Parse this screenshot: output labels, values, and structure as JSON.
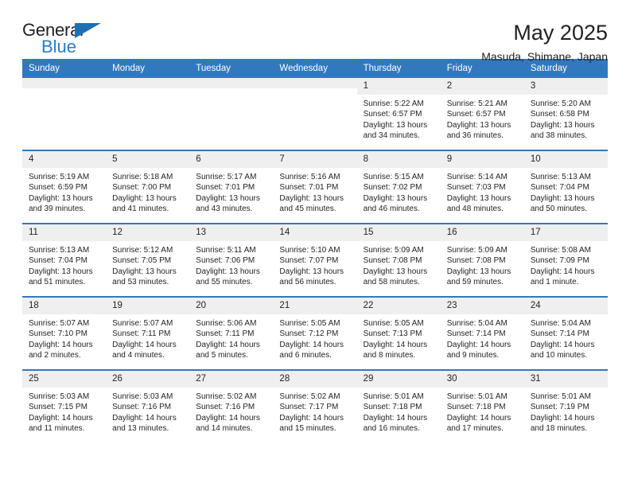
{
  "brand": {
    "name_top": "General",
    "name_bottom": "Blue",
    "triangle_color": "#1f6fb5",
    "text_color": "#2a7cc7"
  },
  "header": {
    "title": "May 2025",
    "subtitle": "Masuda, Shimane, Japan"
  },
  "theme": {
    "header_blue": "#3278be",
    "daynum_gray": "#efefef",
    "text": "#231f20"
  },
  "weekday_headers": [
    "Sunday",
    "Monday",
    "Tuesday",
    "Wednesday",
    "Thursday",
    "Friday",
    "Saturday"
  ],
  "labels": {
    "sunrise_prefix": "Sunrise:",
    "sunset_prefix": "Sunset:",
    "daylight_prefix": "Daylight:"
  },
  "weeks": [
    [
      {
        "day": "",
        "blank": true
      },
      {
        "day": "",
        "blank": true
      },
      {
        "day": "",
        "blank": true
      },
      {
        "day": "",
        "blank": true
      },
      {
        "day": "1",
        "sunrise": "Sunrise: 5:22 AM",
        "sunset": "Sunset: 6:57 PM",
        "daylight": "Daylight: 13 hours and 34 minutes."
      },
      {
        "day": "2",
        "sunrise": "Sunrise: 5:21 AM",
        "sunset": "Sunset: 6:57 PM",
        "daylight": "Daylight: 13 hours and 36 minutes."
      },
      {
        "day": "3",
        "sunrise": "Sunrise: 5:20 AM",
        "sunset": "Sunset: 6:58 PM",
        "daylight": "Daylight: 13 hours and 38 minutes."
      }
    ],
    [
      {
        "day": "4",
        "sunrise": "Sunrise: 5:19 AM",
        "sunset": "Sunset: 6:59 PM",
        "daylight": "Daylight: 13 hours and 39 minutes."
      },
      {
        "day": "5",
        "sunrise": "Sunrise: 5:18 AM",
        "sunset": "Sunset: 7:00 PM",
        "daylight": "Daylight: 13 hours and 41 minutes."
      },
      {
        "day": "6",
        "sunrise": "Sunrise: 5:17 AM",
        "sunset": "Sunset: 7:01 PM",
        "daylight": "Daylight: 13 hours and 43 minutes."
      },
      {
        "day": "7",
        "sunrise": "Sunrise: 5:16 AM",
        "sunset": "Sunset: 7:01 PM",
        "daylight": "Daylight: 13 hours and 45 minutes."
      },
      {
        "day": "8",
        "sunrise": "Sunrise: 5:15 AM",
        "sunset": "Sunset: 7:02 PM",
        "daylight": "Daylight: 13 hours and 46 minutes."
      },
      {
        "day": "9",
        "sunrise": "Sunrise: 5:14 AM",
        "sunset": "Sunset: 7:03 PM",
        "daylight": "Daylight: 13 hours and 48 minutes."
      },
      {
        "day": "10",
        "sunrise": "Sunrise: 5:13 AM",
        "sunset": "Sunset: 7:04 PM",
        "daylight": "Daylight: 13 hours and 50 minutes."
      }
    ],
    [
      {
        "day": "11",
        "sunrise": "Sunrise: 5:13 AM",
        "sunset": "Sunset: 7:04 PM",
        "daylight": "Daylight: 13 hours and 51 minutes."
      },
      {
        "day": "12",
        "sunrise": "Sunrise: 5:12 AM",
        "sunset": "Sunset: 7:05 PM",
        "daylight": "Daylight: 13 hours and 53 minutes."
      },
      {
        "day": "13",
        "sunrise": "Sunrise: 5:11 AM",
        "sunset": "Sunset: 7:06 PM",
        "daylight": "Daylight: 13 hours and 55 minutes."
      },
      {
        "day": "14",
        "sunrise": "Sunrise: 5:10 AM",
        "sunset": "Sunset: 7:07 PM",
        "daylight": "Daylight: 13 hours and 56 minutes."
      },
      {
        "day": "15",
        "sunrise": "Sunrise: 5:09 AM",
        "sunset": "Sunset: 7:08 PM",
        "daylight": "Daylight: 13 hours and 58 minutes."
      },
      {
        "day": "16",
        "sunrise": "Sunrise: 5:09 AM",
        "sunset": "Sunset: 7:08 PM",
        "daylight": "Daylight: 13 hours and 59 minutes."
      },
      {
        "day": "17",
        "sunrise": "Sunrise: 5:08 AM",
        "sunset": "Sunset: 7:09 PM",
        "daylight": "Daylight: 14 hours and 1 minute."
      }
    ],
    [
      {
        "day": "18",
        "sunrise": "Sunrise: 5:07 AM",
        "sunset": "Sunset: 7:10 PM",
        "daylight": "Daylight: 14 hours and 2 minutes."
      },
      {
        "day": "19",
        "sunrise": "Sunrise: 5:07 AM",
        "sunset": "Sunset: 7:11 PM",
        "daylight": "Daylight: 14 hours and 4 minutes."
      },
      {
        "day": "20",
        "sunrise": "Sunrise: 5:06 AM",
        "sunset": "Sunset: 7:11 PM",
        "daylight": "Daylight: 14 hours and 5 minutes."
      },
      {
        "day": "21",
        "sunrise": "Sunrise: 5:05 AM",
        "sunset": "Sunset: 7:12 PM",
        "daylight": "Daylight: 14 hours and 6 minutes."
      },
      {
        "day": "22",
        "sunrise": "Sunrise: 5:05 AM",
        "sunset": "Sunset: 7:13 PM",
        "daylight": "Daylight: 14 hours and 8 minutes."
      },
      {
        "day": "23",
        "sunrise": "Sunrise: 5:04 AM",
        "sunset": "Sunset: 7:14 PM",
        "daylight": "Daylight: 14 hours and 9 minutes."
      },
      {
        "day": "24",
        "sunrise": "Sunrise: 5:04 AM",
        "sunset": "Sunset: 7:14 PM",
        "daylight": "Daylight: 14 hours and 10 minutes."
      }
    ],
    [
      {
        "day": "25",
        "sunrise": "Sunrise: 5:03 AM",
        "sunset": "Sunset: 7:15 PM",
        "daylight": "Daylight: 14 hours and 11 minutes."
      },
      {
        "day": "26",
        "sunrise": "Sunrise: 5:03 AM",
        "sunset": "Sunset: 7:16 PM",
        "daylight": "Daylight: 14 hours and 13 minutes."
      },
      {
        "day": "27",
        "sunrise": "Sunrise: 5:02 AM",
        "sunset": "Sunset: 7:16 PM",
        "daylight": "Daylight: 14 hours and 14 minutes."
      },
      {
        "day": "28",
        "sunrise": "Sunrise: 5:02 AM",
        "sunset": "Sunset: 7:17 PM",
        "daylight": "Daylight: 14 hours and 15 minutes."
      },
      {
        "day": "29",
        "sunrise": "Sunrise: 5:01 AM",
        "sunset": "Sunset: 7:18 PM",
        "daylight": "Daylight: 14 hours and 16 minutes."
      },
      {
        "day": "30",
        "sunrise": "Sunrise: 5:01 AM",
        "sunset": "Sunset: 7:18 PM",
        "daylight": "Daylight: 14 hours and 17 minutes."
      },
      {
        "day": "31",
        "sunrise": "Sunrise: 5:01 AM",
        "sunset": "Sunset: 7:19 PM",
        "daylight": "Daylight: 14 hours and 18 minutes."
      }
    ]
  ]
}
